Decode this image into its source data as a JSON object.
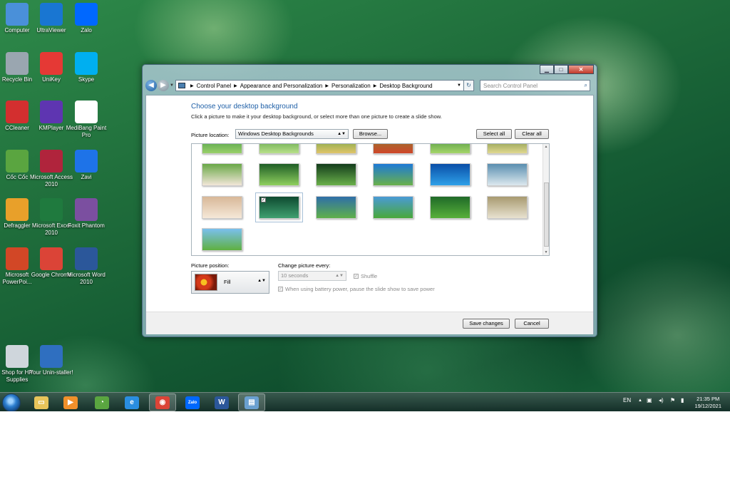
{
  "desktop_icons": [
    {
      "label": "Computer",
      "icon": "computer-icon",
      "color": "#4a90d9"
    },
    {
      "label": "UltraViewer",
      "icon": "ultraviewer-icon",
      "color": "#1976d2"
    },
    {
      "label": "Zalo",
      "icon": "zalo-icon",
      "color": "#0068ff"
    },
    {
      "label": "Recycle Bin",
      "icon": "recycle-bin-icon",
      "color": "#9aa6b0"
    },
    {
      "label": "UniKey",
      "icon": "unikey-icon",
      "color": "#e53935"
    },
    {
      "label": "Skype",
      "icon": "skype-icon",
      "color": "#00aff0"
    },
    {
      "label": "CCleaner",
      "icon": "ccleaner-icon",
      "color": "#d32f2f"
    },
    {
      "label": "KMPlayer",
      "icon": "kmplayer-icon",
      "color": "#5e35b1"
    },
    {
      "label": "MediBang Paint Pro",
      "icon": "medibang-icon",
      "color": "#ffffff"
    },
    {
      "label": "Cốc Cốc",
      "icon": "coccoc-icon",
      "color": "#5aa540"
    },
    {
      "label": "Microsoft Access 2010",
      "icon": "access-icon",
      "color": "#b0243c"
    },
    {
      "label": "Zavi",
      "icon": "zavi-icon",
      "color": "#1e73e8"
    },
    {
      "label": "Defraggler",
      "icon": "defraggler-icon",
      "color": "#e8a02a"
    },
    {
      "label": "Microsoft Excel 2010",
      "icon": "excel-icon",
      "color": "#1f7a3e"
    },
    {
      "label": "Foxit Phantom",
      "icon": "foxit-icon",
      "color": "#7b4fa0"
    },
    {
      "label": "Microsoft PowerPoi...",
      "icon": "powerpoint-icon",
      "color": "#d24726"
    },
    {
      "label": "Google Chrome",
      "icon": "chrome-icon",
      "color": "#db4437"
    },
    {
      "label": "Microsoft Word 2010",
      "icon": "word-icon",
      "color": "#2b579a"
    },
    {
      "label": "Shop for HP Supplies",
      "icon": "hp-printer-icon",
      "color": "#cfd6dc"
    },
    {
      "label": "Your Unin-staller!",
      "icon": "uninstaller-icon",
      "color": "#2f6fc0"
    }
  ],
  "window": {
    "breadcrumb": [
      "Control Panel",
      "Appearance and Personalization",
      "Personalization",
      "Desktop Background"
    ],
    "search_placeholder": "Search Control Panel",
    "title": "Choose your desktop background",
    "subtitle": "Click a picture to make it your desktop background, or select more than one picture to create a slide show.",
    "picture_location_label": "Picture location:",
    "picture_location_value": "Windows Desktop Backgrounds",
    "browse_label": "Browse...",
    "select_all_label": "Select all",
    "clear_all_label": "Clear all",
    "thumbnails": [
      {
        "c1": "#2f8a3a",
        "c2": "#9ad06a"
      },
      {
        "c1": "#3a8a30",
        "c2": "#b8e08a"
      },
      {
        "c1": "#4e9a38",
        "c2": "#e0c46a"
      },
      {
        "c1": "#7a8a30",
        "c2": "#d0462a"
      },
      {
        "c1": "#2e7d32",
        "c2": "#a5d66a"
      },
      {
        "c1": "#5a7a2a",
        "c2": "#e0d890"
      },
      {
        "c1": "#6aa848",
        "c2": "#f2e6d8"
      },
      {
        "c1": "#1f5e26",
        "c2": "#8fcf5e"
      },
      {
        "c1": "#143d1c",
        "c2": "#6ab04a"
      },
      {
        "c1": "#1e7ad6",
        "c2": "#6ab04a"
      },
      {
        "c1": "#0a4fa8",
        "c2": "#2ea0e8"
      },
      {
        "c1": "#5a8fb0",
        "c2": "#dce8ee"
      },
      {
        "c1": "#d8b898",
        "c2": "#f5e8d8"
      },
      {
        "c1": "#0e4a30",
        "c2": "#3fa070"
      },
      {
        "c1": "#2f6fa8",
        "c2": "#5fb04a"
      },
      {
        "c1": "#4a9ad6",
        "c2": "#4aa83a"
      },
      {
        "c1": "#1f6a28",
        "c2": "#58b03a"
      },
      {
        "c1": "#a89a70",
        "c2": "#e8e2d0"
      },
      {
        "c1": "#7ac0ee",
        "c2": "#5fb040"
      }
    ],
    "picture_position_label": "Picture position:",
    "picture_position_value": "Fill",
    "change_picture_label": "Change picture every:",
    "change_picture_value": "10 seconds",
    "shuffle_label": "Shuffle",
    "battery_label": "When using battery power, pause the slide show to save power",
    "save_label": "Save changes",
    "cancel_label": "Cancel",
    "minimize_glyph": "▁",
    "maximize_glyph": "□",
    "close_glyph": "✕",
    "back_glyph": "◀",
    "forward_glyph": "▶",
    "refresh_glyph": "↻",
    "search_glyph": "⌕"
  },
  "taskbar": {
    "apps": [
      {
        "name": "explorer",
        "icon": "folder-icon",
        "glyph": "▭",
        "color": "#e8c45a"
      },
      {
        "name": "media-player",
        "icon": "media-player-icon",
        "glyph": "▶",
        "color": "#f0902a"
      },
      {
        "name": "coccoc",
        "icon": "coccoc-icon",
        "glyph": "◔",
        "color": "#5aa540"
      },
      {
        "name": "internet-explorer",
        "icon": "ie-icon",
        "glyph": "e",
        "color": "#2a8ee0"
      },
      {
        "name": "chrome",
        "icon": "chrome-icon",
        "glyph": "◉",
        "color": "#db4437"
      },
      {
        "name": "zalo",
        "icon": "zalo-icon",
        "glyph": "Zalo",
        "color": "#0068ff"
      },
      {
        "name": "word",
        "icon": "word-icon",
        "glyph": "W",
        "color": "#2b579a"
      },
      {
        "name": "control-panel",
        "icon": "control-panel-icon",
        "glyph": "▤",
        "color": "#6aa0d0"
      }
    ],
    "language": "EN",
    "tray_up": "▲",
    "tray_glyphs": [
      "▣",
      "◂)",
      "⚑",
      "▮"
    ],
    "time": "21:35 PM",
    "date": "19/12/2021"
  }
}
